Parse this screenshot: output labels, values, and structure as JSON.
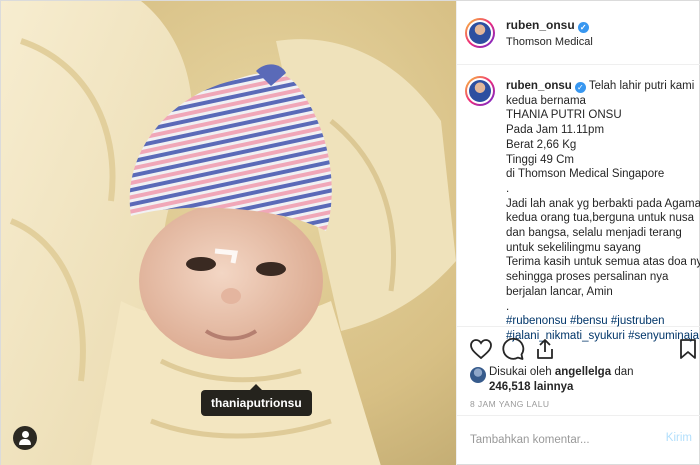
{
  "post": {
    "username": "ruben_onsu",
    "location": "Thomson Medical",
    "photo_tag": "thaniaputrionsu"
  },
  "caption": {
    "username": "ruben_onsu",
    "lines": [
      "Telah lahir putri kami",
      "kedua bernama",
      "THANIA PUTRI ONSU",
      "Pada Jam 11.11pm",
      "Berat 2,66 Kg",
      "Tinggi 49 Cm",
      "di Thomson Medical Singapore",
      ".",
      "Jadi lah anak yg berbakti pada Agama,",
      "kedua orang tua,berguna untuk nusa",
      "dan bangsa, selalu menjadi terang",
      "untuk sekelilingmu sayang",
      "Terima kasih untuk semua atas doa nya",
      "sehingga proses persalinan nya",
      "berjalan lancar, Amin",
      "."
    ],
    "hashtags_line1": "#rubenonsu #bensu #justruben",
    "hashtags_line2": "#jalani_nikmati_syukuri #senyuminaja"
  },
  "likes": {
    "prefix": "Disukai oleh",
    "user": "angellelga",
    "joiner": "dan",
    "count": "246,518",
    "suffix": "lainnya"
  },
  "time_ago": "8 JAM YANG LALU",
  "comment": {
    "placeholder": "Tambahkan komentar...",
    "send_label": "Kirim"
  },
  "icons": [
    "heart-icon",
    "comment-icon",
    "share-icon",
    "bookmark-icon",
    "tagged-user-icon",
    "verified-badge-icon"
  ],
  "colors": {
    "verified": "#3897f0",
    "hashtag": "#003569",
    "send_disabled": "#b2dffc"
  }
}
